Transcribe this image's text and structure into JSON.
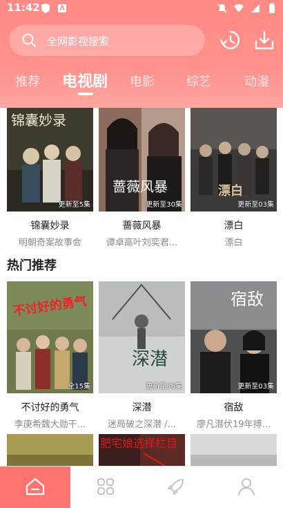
{
  "status_bar": {
    "time": "11:42"
  },
  "search": {
    "placeholder": "全网影视搜索"
  },
  "tabs": [
    {
      "label": "推荐",
      "active": false
    },
    {
      "label": "电视剧",
      "active": true
    },
    {
      "label": "电影",
      "active": false
    },
    {
      "label": "综艺",
      "active": false
    },
    {
      "label": "动漫",
      "active": false
    }
  ],
  "top_row": [
    {
      "title": "锦囊妙录",
      "subtitle": "明朝奇案故事会",
      "badge": "更新至5集",
      "poster_text": "锦囊妙录"
    },
    {
      "title": "蔷薇风暴",
      "subtitle": "谭卓高叶刘奕君...",
      "badge": "更新至30集",
      "poster_text": "蔷薇风暴"
    },
    {
      "title": "漂白",
      "subtitle": "漂白",
      "badge": "更新至03集",
      "poster_text": "漂白"
    }
  ],
  "hot_section": {
    "title": "热门推荐",
    "items": [
      {
        "title": "不讨好的勇气",
        "subtitle": "李庚希魏大勋干...",
        "badge": "全15集",
        "poster_text": "不讨好的勇气"
      },
      {
        "title": "深潜",
        "subtitle": "迷局破之深潜 /...",
        "badge": "更新至36集",
        "poster_text": "深潜"
      },
      {
        "title": "宿敌",
        "subtitle": "廖凡潜伏19年搏...",
        "badge": "更新至03集",
        "poster_text": "宿敌"
      }
    ]
  },
  "partial_row": [
    {
      "poster_text": ""
    },
    {
      "poster_text": ""
    },
    {
      "poster_text": ""
    }
  ],
  "annotation": {
    "text": "肥宅娘选择栏目"
  },
  "bottom_nav": [
    {
      "icon": "home-icon",
      "active": true
    },
    {
      "icon": "category-icon",
      "active": false
    },
    {
      "icon": "rocket-icon",
      "active": false
    },
    {
      "icon": "profile-icon",
      "active": false
    }
  ],
  "colors": {
    "header": "#ff8a85",
    "accent": "#ff7470",
    "annotation": "#e0181e"
  }
}
